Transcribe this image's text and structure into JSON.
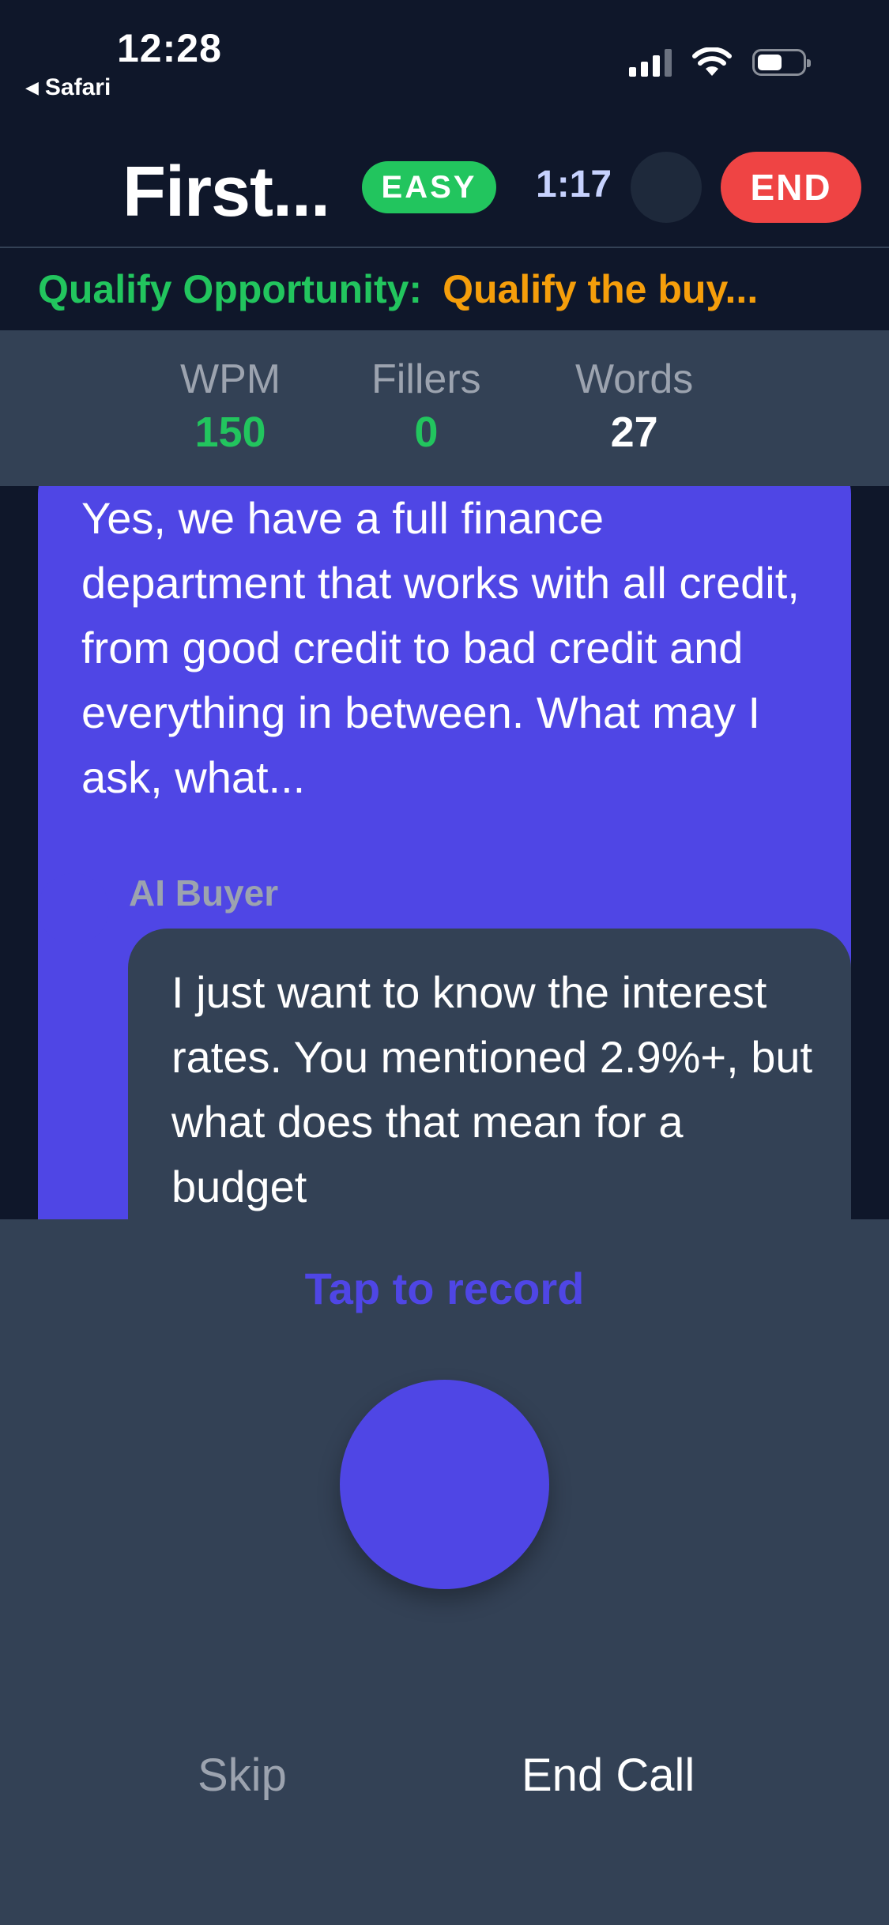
{
  "status_bar": {
    "time": "12:28",
    "back_app": "Safari",
    "back_glyph": "◀",
    "icons": [
      "cellular-signal-icon",
      "wifi-icon",
      "battery-icon"
    ]
  },
  "header": {
    "title": "First...",
    "difficulty": "EASY",
    "timer": "1:17",
    "end_label": "END"
  },
  "objective": {
    "stage": "Qualify Opportunity:",
    "goal": "Qualify the buy..."
  },
  "stats": [
    {
      "label": "WPM",
      "value": "150"
    },
    {
      "label": "Fillers",
      "value": "0"
    },
    {
      "label": "Words",
      "value": "27"
    }
  ],
  "transcript": {
    "user_message": "Yes, we have a full finance department that works with all credit, from good credit to bad credit and everything in between. What may I ask, what...",
    "ai_speaker": "AI Buyer",
    "ai_message": "I just want to know the interest rates. You mentioned 2.9%+, but what does that mean for a budget"
  },
  "controls": {
    "tap_label": "Tap to record",
    "skip_label": "Skip",
    "end_call_label": "End Call"
  },
  "colors": {
    "background": "#0f172a",
    "panel": "#334155",
    "accent": "#4f46e5",
    "success": "#22c55e",
    "warning": "#f59e0b",
    "danger": "#ef4444"
  }
}
